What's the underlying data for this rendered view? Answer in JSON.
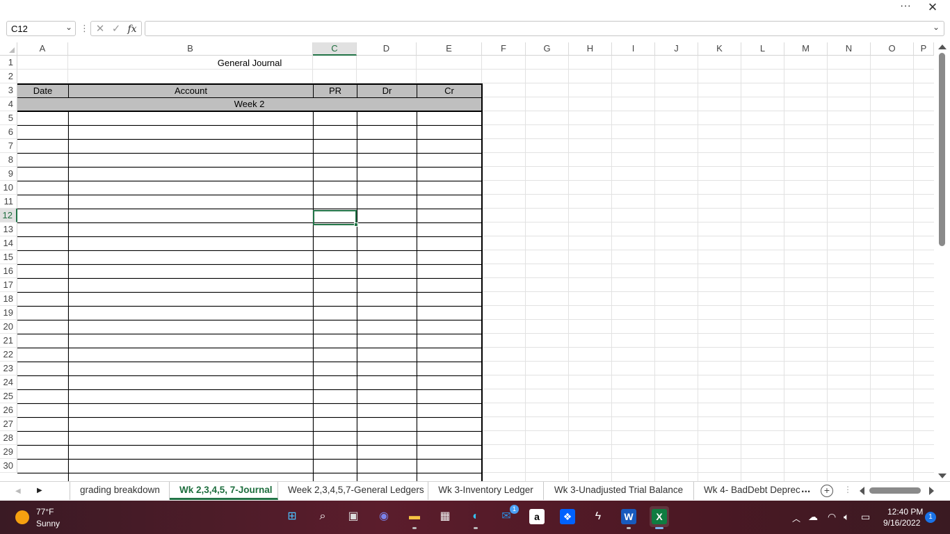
{
  "window": {
    "more_label": "···",
    "close_label": "✕"
  },
  "formula_bar": {
    "name_box": "C12",
    "formula": "",
    "cancel_icon": "✕",
    "enter_icon": "✓",
    "fx_label": "fx"
  },
  "columns": [
    "A",
    "B",
    "C",
    "D",
    "E",
    "F",
    "G",
    "H",
    "I",
    "J",
    "K",
    "L",
    "M",
    "N",
    "O",
    "P"
  ],
  "selected_column": "C",
  "rows": [
    "1",
    "2",
    "3",
    "4",
    "5",
    "6",
    "7",
    "8",
    "9",
    "10",
    "11",
    "12",
    "13",
    "14",
    "15",
    "16",
    "17",
    "18",
    "19",
    "20",
    "21",
    "22",
    "23",
    "24",
    "25",
    "26",
    "27",
    "28",
    "29",
    "30"
  ],
  "selected_row": "12",
  "journal": {
    "title": "General Journal",
    "headers": [
      "Date",
      "Account",
      "PR",
      "Dr",
      "Cr"
    ],
    "section_label": "Week 2"
  },
  "sheet_tabs": [
    {
      "label": "grading breakdown",
      "active": false
    },
    {
      "label": "Wk 2,3,4,5, 7-Journal",
      "active": true
    },
    {
      "label": "Week 2,3,4,5,7-General Ledgers",
      "active": false
    },
    {
      "label": "Wk 3-Inventory Ledger",
      "active": false
    },
    {
      "label": "Wk 3-Unadjusted Trial Balance",
      "active": false
    },
    {
      "label": "Wk 4- BadDebt Deprec",
      "active": false
    }
  ],
  "tabs_overflow": "...",
  "taskbar": {
    "weather_temp": "77°F",
    "weather_desc": "Sunny",
    "apps": [
      {
        "name": "windows-start",
        "glyph": "⊞",
        "color": "#4cc2ff"
      },
      {
        "name": "search",
        "glyph": "⌕",
        "color": "#ffffff"
      },
      {
        "name": "task-view",
        "glyph": "▣",
        "color": "#dddddd"
      },
      {
        "name": "teams-chat",
        "glyph": "◉",
        "color": "#7b83eb"
      },
      {
        "name": "file-explorer",
        "glyph": "▬",
        "color": "#f6c343"
      },
      {
        "name": "microsoft-store",
        "glyph": "▦",
        "color": "#f3f3f3"
      },
      {
        "name": "edge",
        "glyph": "◐",
        "color": "#35c1f1"
      },
      {
        "name": "mail",
        "glyph": "✉",
        "color": "#2b8cde",
        "badge": "1"
      },
      {
        "name": "amazon",
        "glyph": "a",
        "color": "#000000"
      },
      {
        "name": "dropbox",
        "glyph": "❖",
        "color": "#0061fe"
      },
      {
        "name": "app-s",
        "glyph": "ϟ",
        "color": "#ffffff"
      },
      {
        "name": "word",
        "glyph": "W",
        "color": "#185abd"
      },
      {
        "name": "excel",
        "glyph": "X",
        "color": "#107c41"
      }
    ],
    "clock_time": "12:40 PM",
    "clock_date": "9/16/2022",
    "notifications": "1"
  }
}
